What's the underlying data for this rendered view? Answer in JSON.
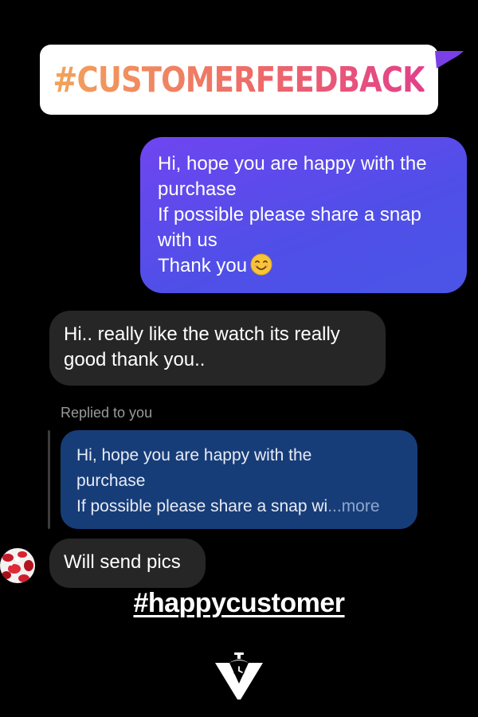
{
  "banner": {
    "title": "#CUSTOMERFEEDBACK"
  },
  "conversation": {
    "outgoing_message": {
      "lines": [
        "Hi, hope you are happy with the",
        "purchase",
        "If possible please share a snap",
        "with us",
        "Thank you"
      ],
      "emoji": "smiling-face-icon"
    },
    "incoming_message_1": {
      "lines": [
        "Hi.. really like the watch its really",
        "good thank you.."
      ]
    },
    "reply": {
      "label": "Replied to you",
      "quoted_lines": [
        "Hi, hope you are happy with the",
        "purchase",
        "If possible please share a snap wi"
      ],
      "more_label": "...more"
    },
    "incoming_message_2": {
      "text": "Will send pics"
    }
  },
  "footer": {
    "hashtag": "#happycustomer",
    "logo_icon": "watch-brand-logo-icon"
  },
  "colors": {
    "background": "#000000",
    "outgoing_bubble": "#5b4ced",
    "incoming_bubble": "#262626",
    "quoted_bubble": "#173d78",
    "banner_gradient_start": "#f2a35a",
    "banner_gradient_end": "#e2408a"
  }
}
